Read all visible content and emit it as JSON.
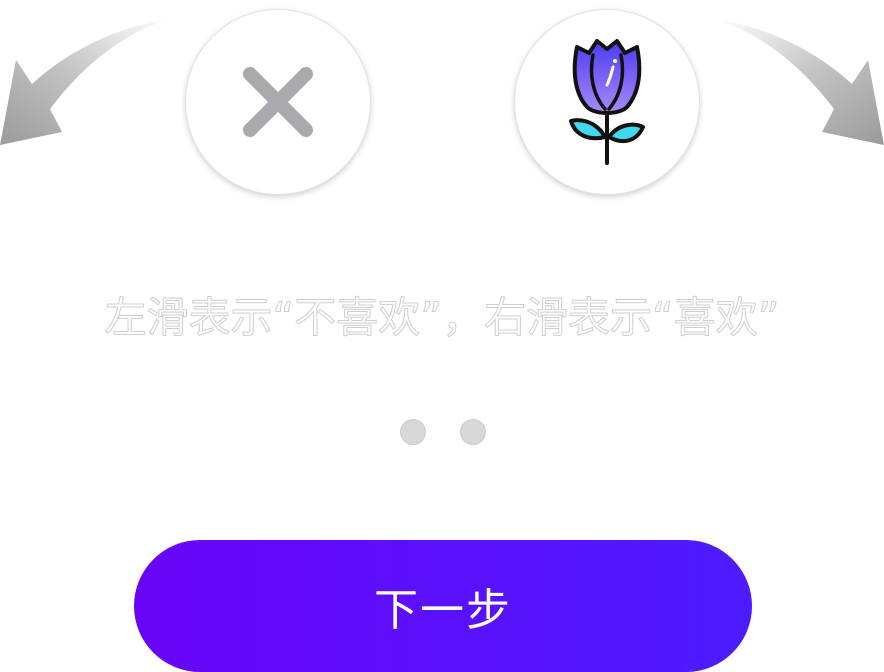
{
  "onboarding": {
    "hint": "左滑表示“不喜欢”，右滑表示“喜欢”",
    "next_label": "下一步"
  },
  "controls": {
    "dislike_icon": "close-icon",
    "like_icon": "rose-icon"
  },
  "pagination": {
    "total": 2
  },
  "colors": {
    "button_gradient_start": "#6a05f7",
    "button_gradient_end": "#4d1bff",
    "dislike_icon": "#a9a9ae",
    "rose_gradient_top": "#4b3bf4",
    "rose_gradient_bottom": "#a98af6",
    "leaf": "#3ed8f0",
    "dot": "#d8d8d8"
  }
}
